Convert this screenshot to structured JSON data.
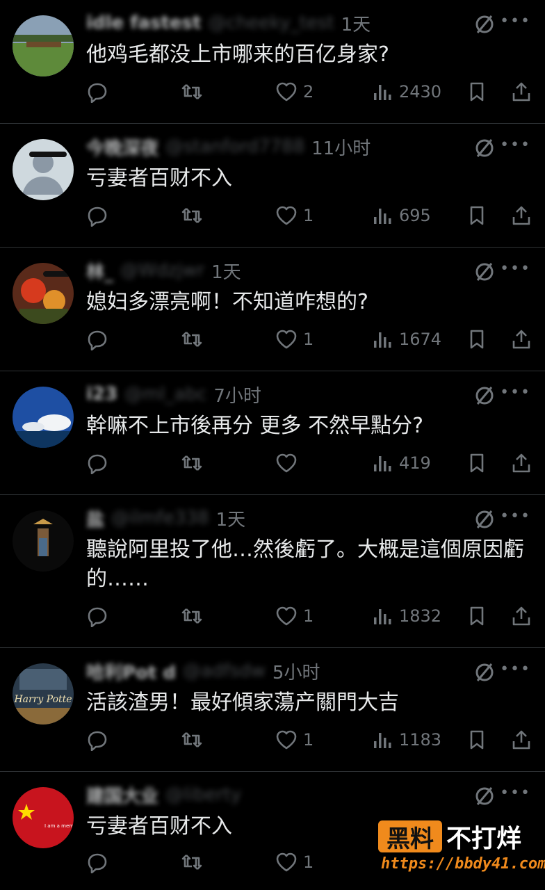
{
  "posts": [
    {
      "name": "idle fastest",
      "handle": "@cheeky_test",
      "time": "1天",
      "text": "他鸡毛都没上市哪来的百亿身家?",
      "likes": "2",
      "views": "2430",
      "avatar": "landscape"
    },
    {
      "name": "今晚深夜",
      "handle": "@stanford7788",
      "time": "11小时",
      "text": "亏妻者百财不入",
      "likes": "1",
      "views": "695",
      "avatar": "default"
    },
    {
      "name": "林_",
      "handle": "@Wdzjwr",
      "time": "1天",
      "text": "媳妇多漂亮啊！不知道咋想的?",
      "likes": "1",
      "views": "1674",
      "avatar": "lantern"
    },
    {
      "name": "i23",
      "handle": "@ml_abc",
      "time": "7小时",
      "text": "幹嘛不上市後再分 更多 不然早點分?",
      "likes": "",
      "views": "419",
      "avatar": "sky"
    },
    {
      "name": "盐",
      "handle": "@ilmfe338",
      "time": "1天",
      "text": "聽說阿里投了他…然後虧了。大概是這個原因虧的……",
      "likes": "1",
      "views": "1832",
      "avatar": "figure"
    },
    {
      "name": "哈利Pot d",
      "handle": "@adfsdw",
      "time": "5小时",
      "text": "活該渣男！最好傾家蕩产關門大吉",
      "likes": "1",
      "views": "1183",
      "avatar": "harry"
    },
    {
      "name": "建国大业",
      "handle": "@liberty",
      "time": "",
      "text": "亏妻者百财不入",
      "likes": "1",
      "views": "",
      "avatar": "flag"
    }
  ],
  "watermark": {
    "box": "黑料",
    "right": "不打烊",
    "url": "https://bbdy41.com"
  },
  "harry_text": "Harry Potte",
  "flag_text": "I am a member of the Communist Party of China",
  "colors": {
    "bg": "#000000",
    "text": "#e7e9ea",
    "muted": "#71767b",
    "divider": "#2f3336",
    "brand": "#f08a1c"
  }
}
